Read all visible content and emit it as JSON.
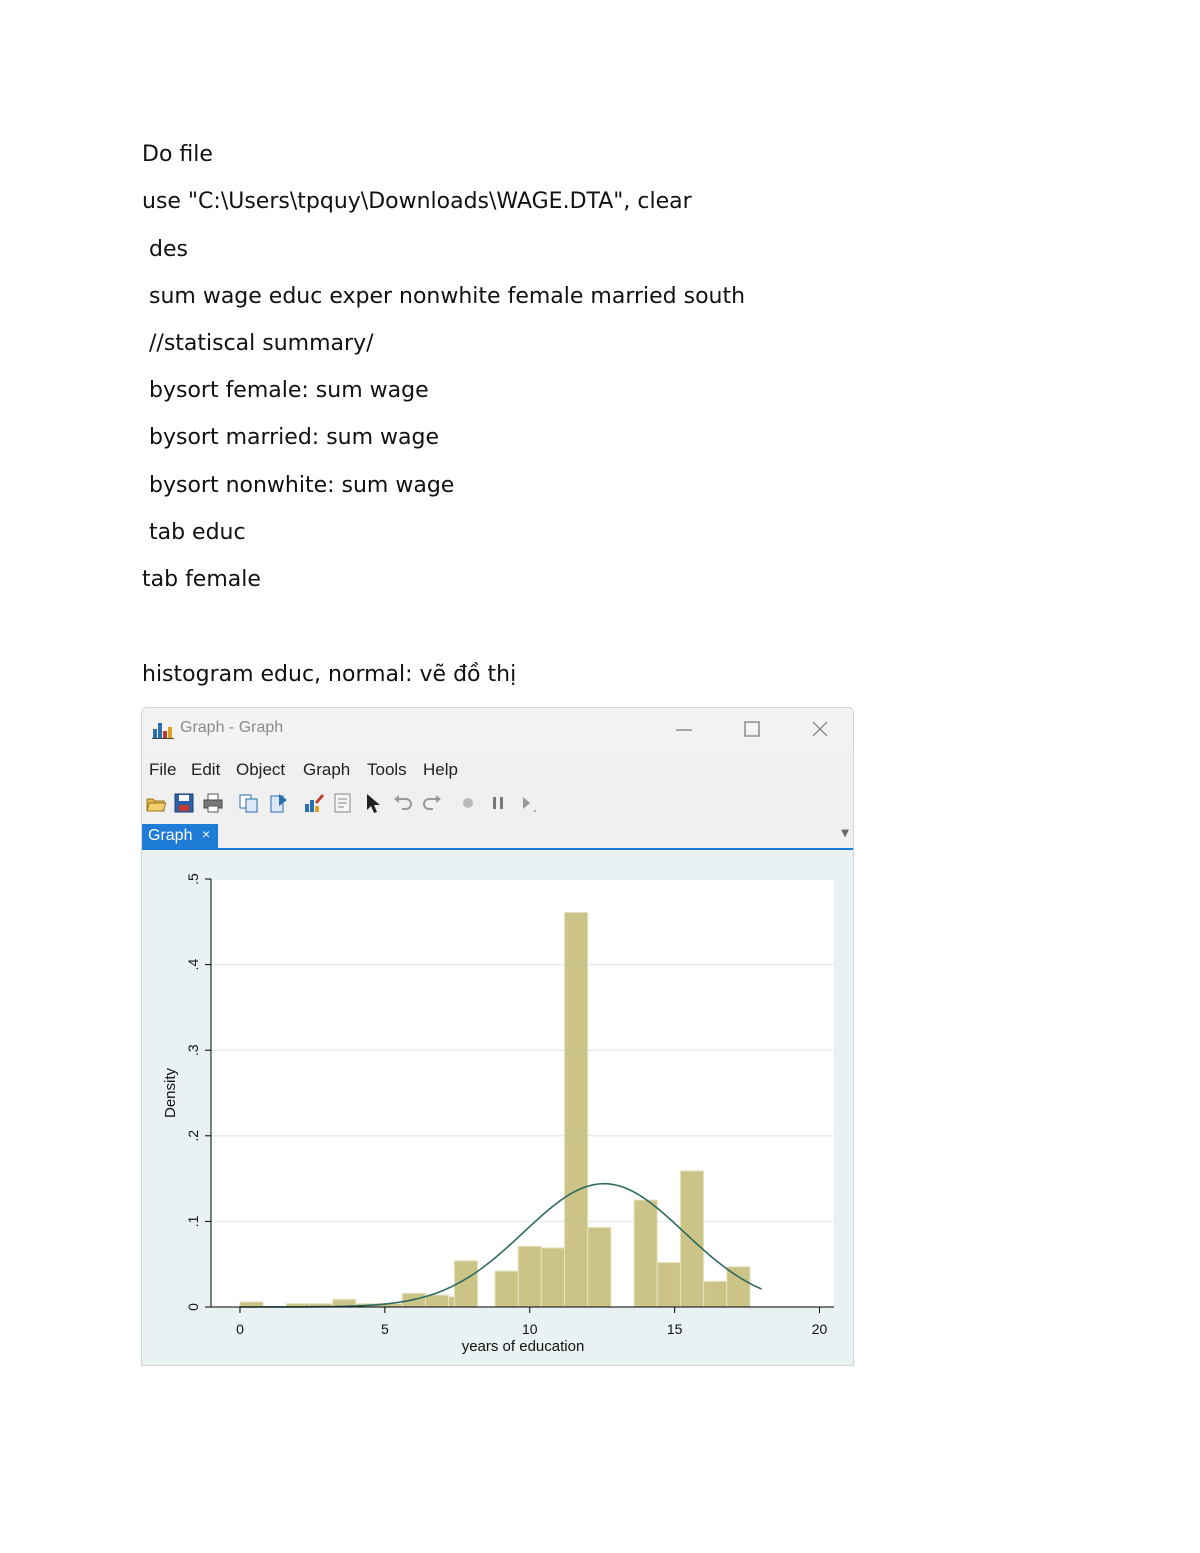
{
  "doc": {
    "lines": [
      "Do file",
      "use \"C:\\Users\\tpquy\\Downloads\\WAGE.DTA\", clear",
      " des",
      " sum wage educ exper nonwhite female married south",
      " //statiscal summary/",
      " bysort female: sum wage",
      " bysort married: sum wage",
      " bysort nonwhite: sum wage",
      " tab educ",
      "tab female",
      "histogram educ, normal: vẽ đồ thị"
    ]
  },
  "window": {
    "title": "Graph - Graph",
    "menu": [
      "File",
      "Edit",
      "Object",
      "Graph",
      "Tools",
      "Help"
    ],
    "tab_label": "Graph",
    "tab_close": "×",
    "toolbar_icons": [
      "open-icon",
      "save-icon",
      "print-icon",
      "copy-icon",
      "export-icon",
      "graph-editor-icon",
      "recorder-icon",
      "pointer-icon",
      "undo-icon",
      "redo-icon",
      "record-icon",
      "pause-icon",
      "play-icon"
    ]
  },
  "colors": {
    "bar_fill": "#cbc486",
    "bar_stroke": "#e8e4c4",
    "normal_curve": "#2e6a60",
    "plot_bg": "#ffffff",
    "outer_bg": "#eaf1f3",
    "tab_accent": "#1e7bd6"
  },
  "chart_data": {
    "type": "bar",
    "xlabel": "years of education",
    "ylabel": "Density",
    "xlim": [
      -1,
      20.5
    ],
    "ylim": [
      0,
      0.5
    ],
    "xticks": [
      0,
      5,
      10,
      15,
      20
    ],
    "xtick_labels": [
      "0",
      "5",
      "10",
      "15",
      "20"
    ],
    "yticks": [
      0,
      0.1,
      0.2,
      0.3,
      0.4,
      0.5
    ],
    "ytick_labels": [
      "0",
      ".1",
      ".2",
      ".3",
      ".4",
      ".5"
    ],
    "grid": true,
    "bin_width": 0.8,
    "bins": [
      {
        "x0": 0.0,
        "density": 0.006
      },
      {
        "x0": 1.6,
        "density": 0.004
      },
      {
        "x0": 2.4,
        "density": 0.004
      },
      {
        "x0": 3.2,
        "density": 0.009
      },
      {
        "x0": 4.0,
        "density": 0.004
      },
      {
        "x0": 4.8,
        "density": 0.004
      },
      {
        "x0": 5.6,
        "density": 0.016
      },
      {
        "x0": 6.4,
        "density": 0.014
      },
      {
        "x0": 7.2,
        "density": 0.012
      },
      {
        "x0": 7.4,
        "density": 0.054
      },
      {
        "x0": 8.8,
        "density": 0.042
      },
      {
        "x0": 9.6,
        "density": 0.071
      },
      {
        "x0": 10.4,
        "density": 0.069
      },
      {
        "x0": 11.2,
        "density": 0.461
      },
      {
        "x0": 12.0,
        "density": 0.093
      },
      {
        "x0": 13.6,
        "density": 0.125
      },
      {
        "x0": 14.4,
        "density": 0.052
      },
      {
        "x0": 15.2,
        "density": 0.159
      },
      {
        "x0": 16.0,
        "density": 0.03
      },
      {
        "x0": 16.8,
        "density": 0.047
      }
    ],
    "normal_overlay": {
      "mean": 12.56,
      "sd": 2.77,
      "x_range": [
        0,
        18
      ]
    }
  }
}
